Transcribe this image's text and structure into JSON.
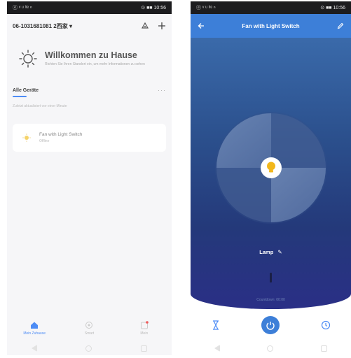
{
  "left": {
    "status_bar": {
      "left": "ⓔ ᵛ ᵘ ˡᵗᵉ ⁿ",
      "right": "⊙ ■■ 10:56"
    },
    "home_name": "06-1031681081 2西家 ▾",
    "welcome": {
      "title": "Willkommen zu Hause",
      "subtitle": "Richten Sie Ihren Standort ein, um mehr Informationen zu sehen"
    },
    "devices_tab": "Alle Geräte",
    "more": "···",
    "devices_note": "Zuletzt aktualisiert vor einer Minute",
    "device": {
      "name": "Fan with Light Switch",
      "status": "Offline"
    },
    "nav": [
      {
        "label": "Mein Zuhause",
        "icon": "home-icon"
      },
      {
        "label": "Smart",
        "icon": "smart-icon"
      },
      {
        "label": "Mein",
        "icon": "profile-icon"
      }
    ]
  },
  "right": {
    "status_bar": {
      "left": "ⓔ ᵛ ᵘ ˡᵗᵉ ⁿ",
      "right": "⊙ ■■ 10:56"
    },
    "title": "Fan with Light Switch",
    "lamp_label": "Lamp",
    "countdown": "Countdown: 00:00",
    "colors": {
      "header": "#3d7fd8",
      "bulb": "#f2b71b"
    }
  }
}
